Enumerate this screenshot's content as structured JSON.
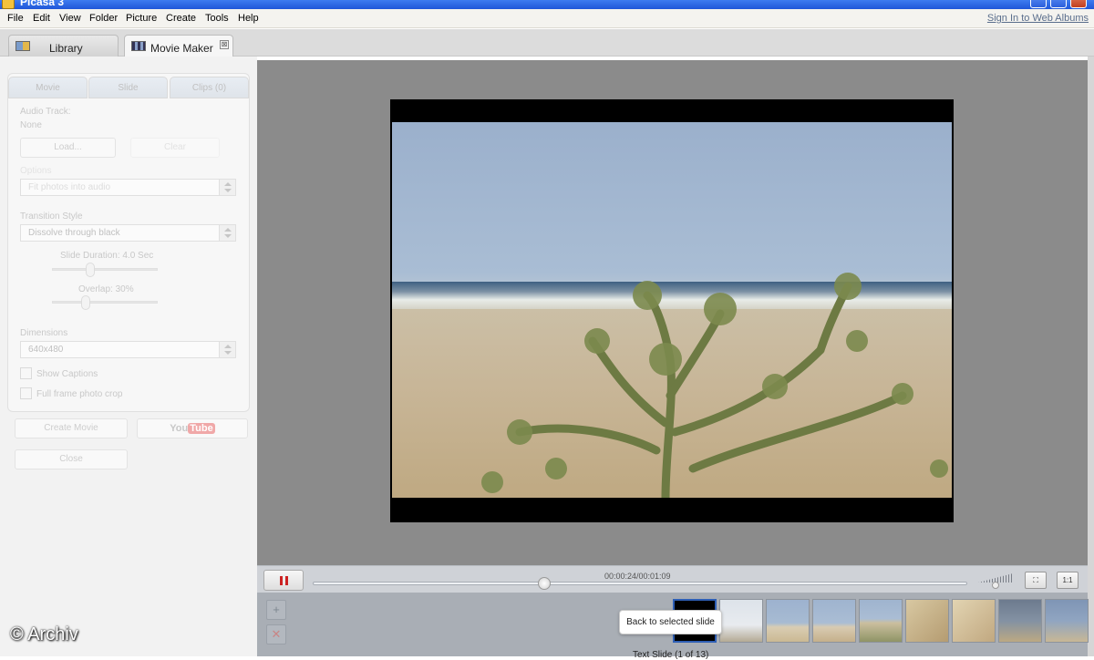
{
  "window": {
    "title": "Picasa 3"
  },
  "menu": [
    "File",
    "Edit",
    "View",
    "Folder",
    "Picture",
    "Create",
    "Tools",
    "Help"
  ],
  "signin_link": "Sign In to Web Albums",
  "tabs": [
    {
      "label": "Library"
    },
    {
      "label": "Movie Maker",
      "close": "⊠"
    }
  ],
  "panel": {
    "subtabs": [
      "Movie",
      "Slide",
      "Clips (0)"
    ],
    "audio_track_label": "Audio Track:",
    "audio_track_value": "None",
    "load_button": "Load...",
    "clear_button": "Clear",
    "options_label": "Options",
    "options_value": "Fit photos into audio",
    "transition_label": "Transition Style",
    "transition_value": "Dissolve through black",
    "duration_label": "Slide Duration: 4.0 Sec",
    "duration_level": 0.35,
    "overlap_label": "Overlap: 30%",
    "overlap_level": 0.3,
    "dimensions_label": "Dimensions",
    "dimensions_value": "640x480",
    "show_captions": "Show Captions",
    "full_frame": "Full frame photo crop",
    "create_movie": "Create Movie",
    "youtube_you": "You",
    "youtube_tube": "Tube",
    "close_button": "Close"
  },
  "player": {
    "time": "00:00:24/00:01:09",
    "progress": 0.35
  },
  "filmstrip": {
    "tooltip": "Back to selected slide",
    "caption": "Text Slide    (1 of 13)"
  },
  "watermark": "© Archiv"
}
